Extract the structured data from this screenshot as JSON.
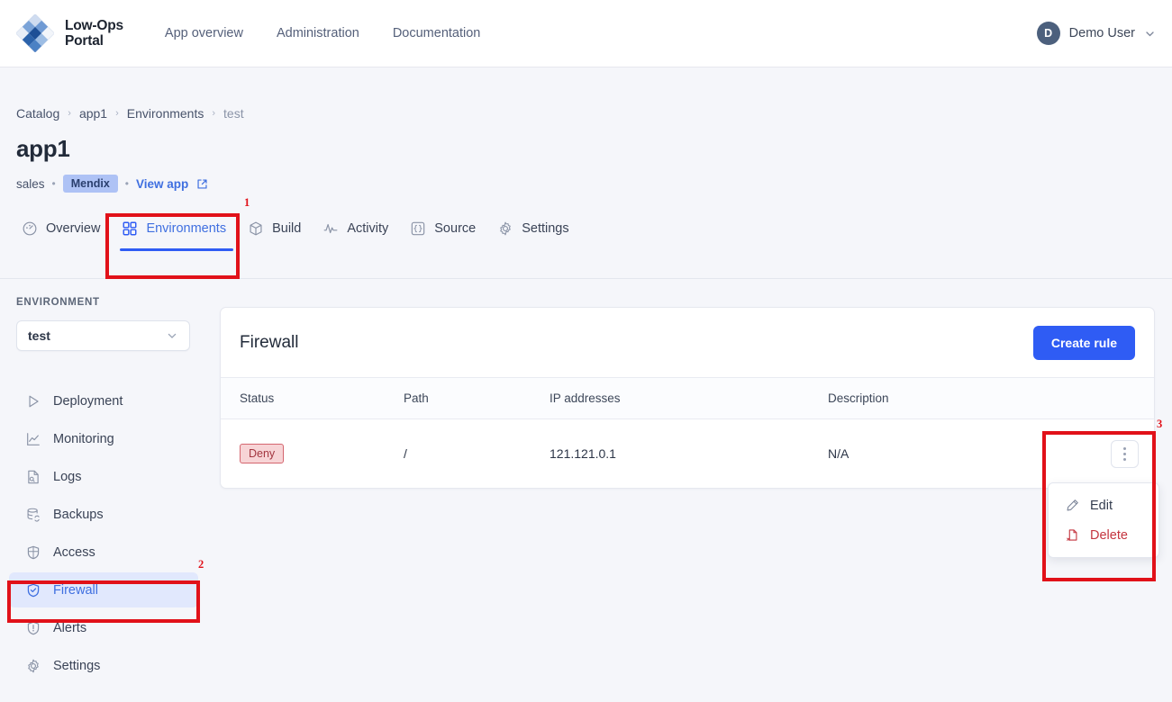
{
  "topnav": {
    "brand_line1": "Low-Ops",
    "brand_line2": "Portal",
    "logo_icon": "diamond-grid-logo",
    "links": [
      {
        "label": "App overview",
        "name": "nav-app-overview"
      },
      {
        "label": "Administration",
        "name": "nav-administration"
      },
      {
        "label": "Documentation",
        "name": "nav-documentation"
      }
    ],
    "user": {
      "initial": "D",
      "name": "Demo User",
      "chevron_icon": "chevron-down-icon"
    }
  },
  "breadcrumb": {
    "items": [
      "Catalog",
      "app1",
      "Environments",
      "test"
    ],
    "separator": "›"
  },
  "header": {
    "title": "app1",
    "owner": "sales",
    "platform_badge": "Mendix",
    "view_app_label": "View app",
    "external_link_icon": "external-link-icon",
    "dot": "•"
  },
  "tabs": [
    {
      "label": "Overview",
      "icon": "gauge-icon",
      "active": false
    },
    {
      "label": "Environments",
      "icon": "grid-squares-icon",
      "active": true
    },
    {
      "label": "Build",
      "icon": "box-icon",
      "active": false
    },
    {
      "label": "Activity",
      "icon": "pulse-icon",
      "active": false
    },
    {
      "label": "Source",
      "icon": "braces-icon",
      "active": false
    },
    {
      "label": "Settings",
      "icon": "gear-icon",
      "active": false
    }
  ],
  "sidebar": {
    "section_label": "ENVIRONMENT",
    "env_select": {
      "value": "test",
      "chevron_icon": "chevron-down-icon"
    },
    "items": [
      {
        "label": "Deployment",
        "icon": "play-triangle-icon",
        "active": false
      },
      {
        "label": "Monitoring",
        "icon": "chart-line-icon",
        "active": false
      },
      {
        "label": "Logs",
        "icon": "document-search-icon",
        "active": false
      },
      {
        "label": "Backups",
        "icon": "database-sync-icon",
        "active": false
      },
      {
        "label": "Access",
        "icon": "shield-icon",
        "active": false
      },
      {
        "label": "Firewall",
        "icon": "shield-check-icon",
        "active": true
      },
      {
        "label": "Alerts",
        "icon": "shield-alert-icon",
        "active": false
      },
      {
        "label": "Settings",
        "icon": "gear-icon",
        "active": false
      }
    ]
  },
  "card": {
    "title": "Firewall",
    "create_button": "Create rule",
    "columns": [
      "Status",
      "Path",
      "IP addresses",
      "Description"
    ],
    "rows": [
      {
        "status": "Deny",
        "path": "/",
        "ip_addresses": "121.121.0.1",
        "description": "N/A",
        "actions_icon": "kebab-menu-icon"
      }
    ]
  },
  "context_menu": {
    "items": [
      {
        "label": "Edit",
        "icon": "pencil-icon",
        "danger": false
      },
      {
        "label": "Delete",
        "icon": "file-delete-icon",
        "danger": true
      }
    ]
  },
  "annotations": [
    {
      "number": "1",
      "target": "environments-tab"
    },
    {
      "number": "2",
      "target": "firewall-sidebar-item"
    },
    {
      "number": "3",
      "target": "row-actions-menu"
    }
  ],
  "colors": {
    "accent_blue": "#2f5cf4",
    "link_blue": "#3f6fe0",
    "active_bg": "#e1e8fd",
    "deny_bg": "#f7d4d6",
    "deny_border": "#d4656e",
    "deny_text": "#a33640",
    "annotation_red": "#e11119",
    "page_bg": "#f5f6fa"
  }
}
